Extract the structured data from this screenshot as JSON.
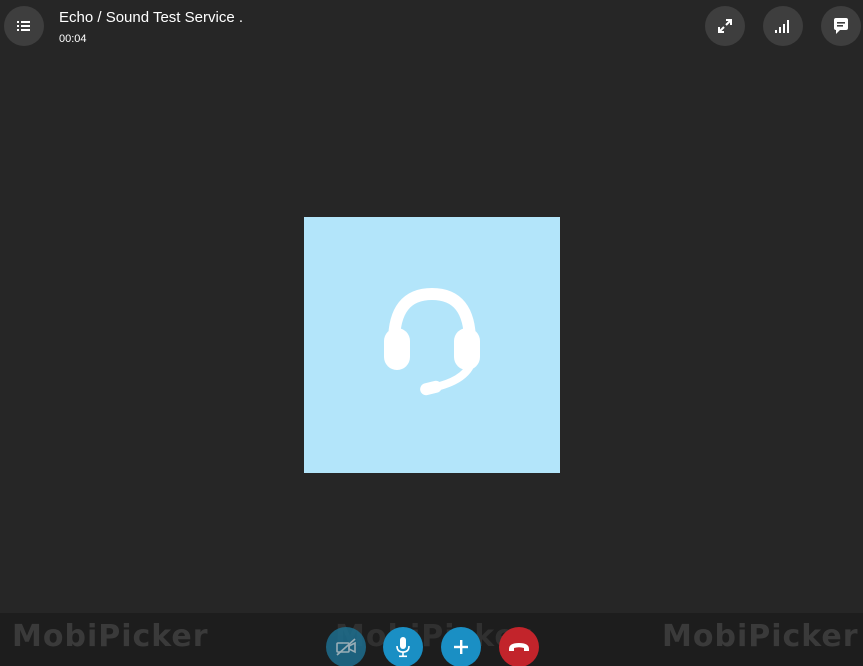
{
  "header": {
    "title": "Echo / Sound Test Service .",
    "timer": "00:04",
    "menu_icon": "list-icon",
    "expand_icon": "expand-icon",
    "signal_icon": "signal-bars-icon",
    "chat_icon": "chat-bubble-icon"
  },
  "avatar": {
    "icon": "headset-icon",
    "background": "#b3e5fa"
  },
  "bottom_bar": {
    "watermark": "MobiPicker",
    "controls": [
      {
        "name": "video-off",
        "icon": "video-off-icon",
        "color": "#1d6e8e"
      },
      {
        "name": "microphone",
        "icon": "microphone-icon",
        "color": "#1a8fc4"
      },
      {
        "name": "add-participant",
        "icon": "plus-icon",
        "color": "#1a8fc4"
      },
      {
        "name": "hang-up",
        "icon": "phone-hangup-icon",
        "color": "#c2242b"
      }
    ]
  },
  "colors": {
    "background": "#262626",
    "button_bg": "#3e3e3e",
    "accent": "#1a8fc4",
    "danger": "#c2242b"
  }
}
